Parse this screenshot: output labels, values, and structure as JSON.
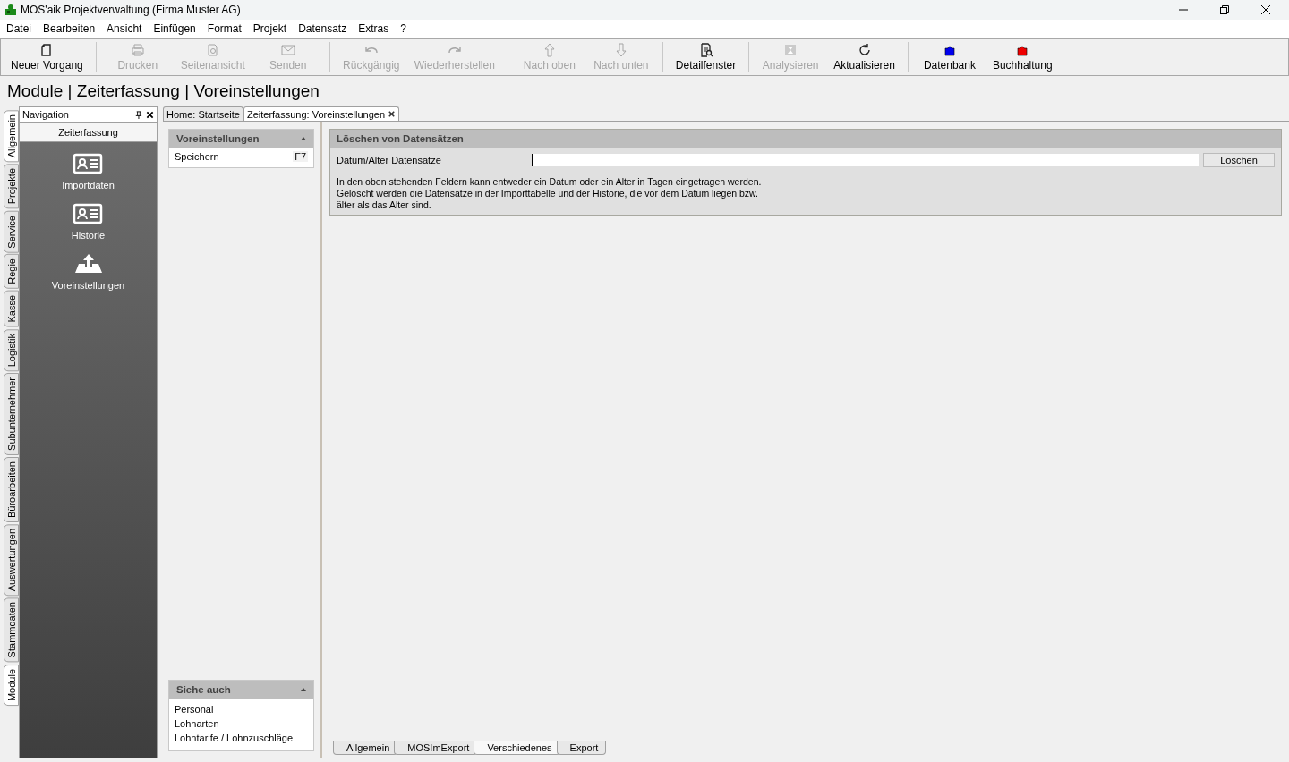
{
  "window": {
    "title": "MOS'aik Projektverwaltung (Firma Muster AG)"
  },
  "menu": [
    "Datei",
    "Bearbeiten",
    "Ansicht",
    "Einfügen",
    "Format",
    "Projekt",
    "Datensatz",
    "Extras",
    "?"
  ],
  "toolbar_groups": [
    {
      "buttons": [
        {
          "label": "Neuer Vorgang",
          "kind": "new",
          "disabled": false
        }
      ]
    },
    {
      "buttons": [
        {
          "label": "Drucken",
          "kind": "print",
          "disabled": true
        },
        {
          "label": "Seitenansicht",
          "kind": "preview",
          "disabled": true
        },
        {
          "label": "Senden",
          "kind": "mail",
          "disabled": true
        }
      ]
    },
    {
      "buttons": [
        {
          "label": "Rückgängig",
          "kind": "undo",
          "disabled": true
        },
        {
          "label": "Wiederherstellen",
          "kind": "redo",
          "disabled": true
        }
      ]
    },
    {
      "buttons": [
        {
          "label": "Nach oben",
          "kind": "up",
          "disabled": true
        },
        {
          "label": "Nach unten",
          "kind": "down",
          "disabled": true
        }
      ]
    },
    {
      "buttons": [
        {
          "label": "Detailfenster",
          "kind": "detail",
          "disabled": false
        }
      ]
    },
    {
      "buttons": [
        {
          "label": "Analysieren",
          "kind": "analyze",
          "disabled": true
        },
        {
          "label": "Aktualisieren",
          "kind": "refresh",
          "disabled": false
        }
      ]
    },
    {
      "buttons": [
        {
          "label": "Datenbank",
          "kind": "puzzle",
          "color": "#0000ee",
          "disabled": false
        },
        {
          "label": "Buchhaltung",
          "kind": "puzzle",
          "color": "#ee0000",
          "disabled": false
        }
      ]
    }
  ],
  "breadcrumb": "Module | Zeiterfassung | Voreinstellungen",
  "side_tabs": [
    {
      "label": "Allgemein",
      "selected": true
    },
    {
      "label": "Projekte",
      "selected": false
    },
    {
      "label": "Service",
      "selected": false
    },
    {
      "label": "Regie",
      "selected": false
    },
    {
      "label": "Kasse",
      "selected": false
    },
    {
      "label": "Logistik",
      "selected": false
    },
    {
      "label": "Subunternehmer",
      "selected": false
    },
    {
      "label": "Büroarbeiten",
      "selected": false
    },
    {
      "label": "Auswertungen",
      "selected": false
    },
    {
      "label": "Stammdaten",
      "selected": false
    },
    {
      "label": "Module",
      "selected": true
    }
  ],
  "navigation": {
    "title": "Navigation",
    "section": "Zeiterfassung",
    "items": [
      {
        "label": "Importdaten",
        "kind": "card"
      },
      {
        "label": "Historie",
        "kind": "card"
      },
      {
        "label": "Voreinstellungen",
        "kind": "upload"
      }
    ]
  },
  "doc_tabs": [
    {
      "label": "Home: Startseite",
      "selected": false
    },
    {
      "label": "Zeiterfassung: Voreinstellungen",
      "selected": true
    }
  ],
  "task_panel": {
    "title": "Voreinstellungen",
    "items": [
      {
        "label": "Speichern",
        "shortcut": "F7"
      }
    ]
  },
  "see_also": {
    "title": "Siehe auch",
    "items": [
      "Personal",
      "Lohnarten",
      "Lohntarife / Lohnzuschläge"
    ]
  },
  "section": {
    "title": "Löschen von Datensätzen",
    "field_label": "Datum/Alter Datensätze",
    "button": "Löschen",
    "help": [
      "In den oben stehenden Feldern kann entweder ein  Datum oder ein Alter in Tagen eingetragen werden.",
      "Gelöscht werden die Datensätze in der Importtabelle und der Historie, die vor dem Datum liegen bzw.",
      "älter als das Alter sind."
    ]
  },
  "bottom_tabs": [
    {
      "label": "Allgemein",
      "selected": false
    },
    {
      "label": "MOSImExport",
      "selected": false
    },
    {
      "label": "Verschiedenes",
      "selected": true
    },
    {
      "label": "Export",
      "selected": false
    }
  ]
}
